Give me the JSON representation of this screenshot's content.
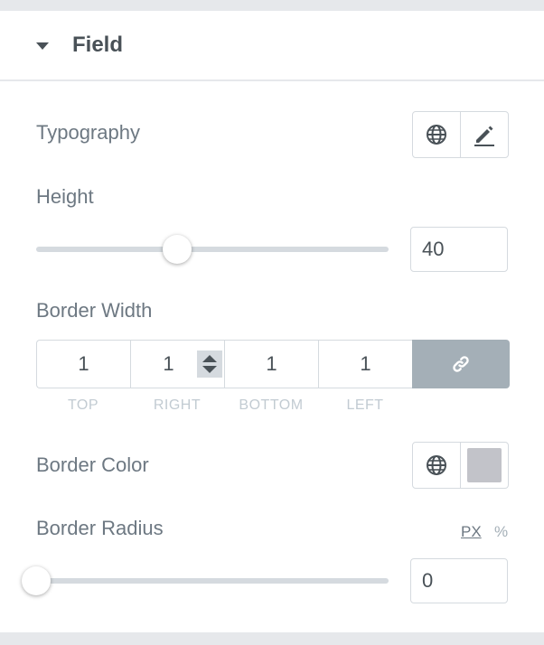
{
  "section": {
    "title": "Field"
  },
  "typography": {
    "label": "Typography"
  },
  "height": {
    "label": "Height",
    "value": "40",
    "slider_fraction": 0.4
  },
  "border_width": {
    "label": "Border Width",
    "top": "1",
    "right": "1",
    "bottom": "1",
    "left": "1",
    "top_label": "TOP",
    "right_label": "RIGHT",
    "bottom_label": "BOTTOM",
    "left_label": "LEFT"
  },
  "border_color": {
    "label": "Border Color",
    "swatch_color": "#c2c3c9"
  },
  "border_radius": {
    "label": "Border Radius",
    "value": "0",
    "unit_px": "PX",
    "unit_percent": "%",
    "slider_fraction": 0
  },
  "colors": {
    "text": "#6d7882",
    "heading": "#495157",
    "border": "#d5dadf",
    "link_button": "#a4afb7"
  }
}
